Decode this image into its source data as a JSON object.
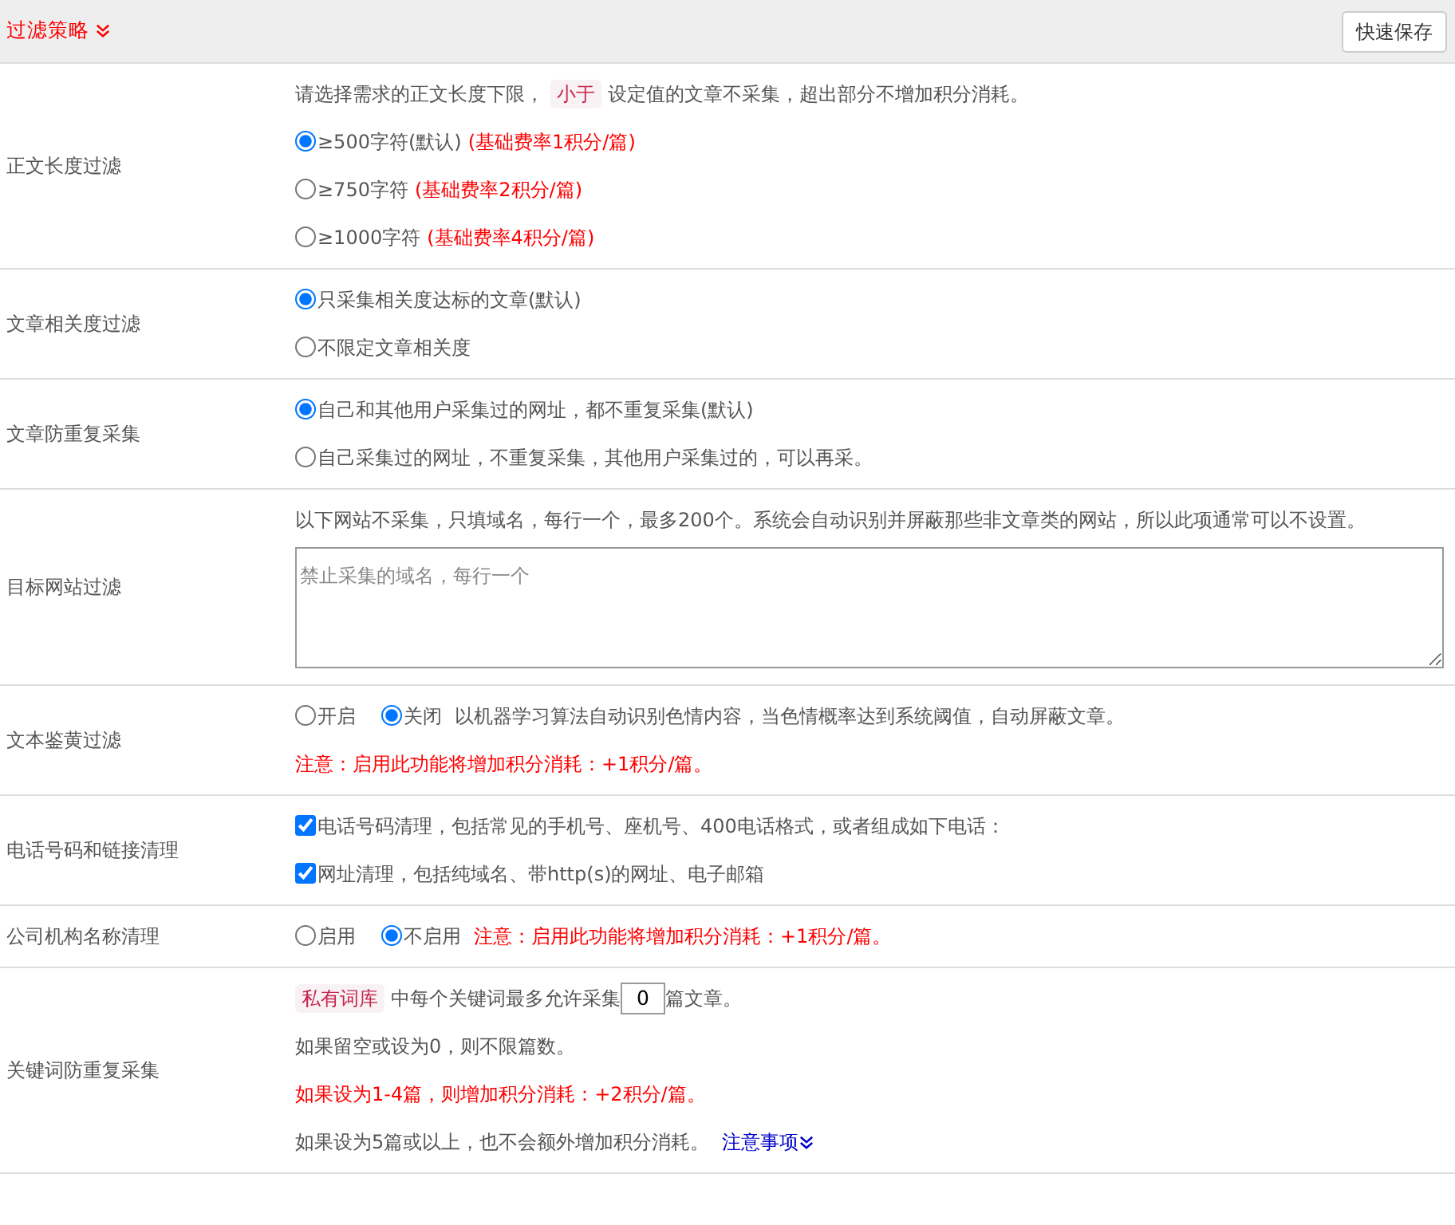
{
  "header": {
    "title": "过滤策略",
    "save_button": "快速保存"
  },
  "sections": [
    {
      "label": "正文长度过滤",
      "lines": [
        {
          "kind": "tagged",
          "before": "请选择需求的正文长度下限，",
          "tag": "小于",
          "after": "设定值的文章不采集，超出部分不增加积分消耗。"
        },
        {
          "kind": "radio",
          "label": "≥500字符(默认)",
          "note": "(基础费率1积分/篇)",
          "selected": true
        },
        {
          "kind": "radio",
          "label": "≥750字符",
          "note": "(基础费率2积分/篇)",
          "selected": false
        },
        {
          "kind": "radio",
          "label": "≥1000字符",
          "note": "(基础费率4积分/篇)",
          "selected": false
        }
      ]
    },
    {
      "label": "文章相关度过滤",
      "lines": [
        {
          "kind": "radio",
          "label": "只采集相关度达标的文章(默认)",
          "selected": true
        },
        {
          "kind": "radio",
          "label": "不限定文章相关度",
          "selected": false
        }
      ]
    },
    {
      "label": "文章防重复采集",
      "lines": [
        {
          "kind": "radio",
          "label": "自己和其他用户采集过的网址，都不重复采集(默认)",
          "selected": true
        },
        {
          "kind": "radio",
          "label": "自己采集过的网址，不重复采集，其他用户采集过的，可以再采。",
          "selected": false
        }
      ]
    },
    {
      "label": "目标网站过滤",
      "lines": [
        {
          "kind": "text",
          "warning": false,
          "text": "以下网站不采集，只填域名，每行一个，最多200个。系统会自动识别并屏蔽那些非文章类的网站，所以此项通常可以不设置。"
        },
        {
          "kind": "textarea",
          "placeholder": "禁止采集的域名，每行一个"
        }
      ]
    },
    {
      "label": "文本鉴黄过滤",
      "lines": [
        {
          "kind": "radio-row",
          "options": [
            {
              "label": "开启",
              "selected": false
            },
            {
              "label": "关闭",
              "selected": true
            }
          ],
          "text": "以机器学习算法自动识别色情内容，当色情概率达到系统阈值，自动屏蔽文章。",
          "warning": false
        },
        {
          "kind": "text",
          "warning": true,
          "text": "注意：启用此功能将增加积分消耗：+1积分/篇。"
        }
      ]
    },
    {
      "label": "电话号码和链接清理",
      "lines": [
        {
          "kind": "checkbox",
          "label": "电话号码清理，包括常见的手机号、座机号、400电话格式，或者组成如下电话：",
          "checked": true
        },
        {
          "kind": "checkbox",
          "label": "网址清理，包括纯域名、带http(s)的网址、电子邮箱",
          "checked": true
        }
      ]
    },
    {
      "label": "公司机构名称清理",
      "lines": [
        {
          "kind": "radio-row",
          "options": [
            {
              "label": "启用",
              "selected": false
            },
            {
              "label": "不启用",
              "selected": true
            }
          ],
          "text": "注意：启用此功能将增加积分消耗：+1积分/篇。",
          "warning": true
        }
      ]
    },
    {
      "label": "关键词防重复采集",
      "lines": [
        {
          "kind": "count",
          "tag": "私有词库",
          "before": "中每个关键词最多允许采集",
          "value": "0",
          "after": "篇文章。"
        },
        {
          "kind": "text",
          "warning": false,
          "text": "如果留空或设为0，则不限篇数。"
        },
        {
          "kind": "text",
          "warning": true,
          "text": "如果设为1-4篇，则增加积分消耗：+2积分/篇。"
        },
        {
          "kind": "text-link",
          "text": "如果设为5篇或以上，也不会额外增加积分消耗。",
          "link": "注意事项"
        }
      ]
    }
  ]
}
